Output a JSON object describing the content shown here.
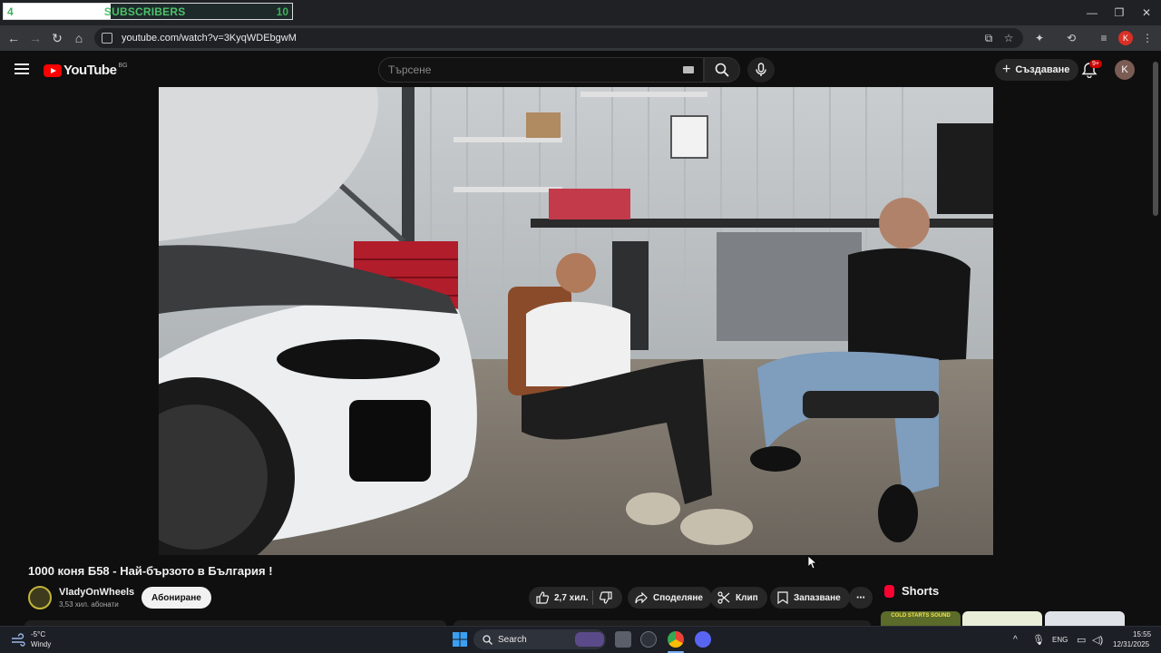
{
  "widget": {
    "left": "4",
    "label": "SUBSCRIBERS",
    "right": "10"
  },
  "browser": {
    "url": "youtube.com/watch?v=3KyqWDEbgwM",
    "profile_initial": "K"
  },
  "yt": {
    "logo_text": "YouTube",
    "region": "BG",
    "search_placeholder": "Търсене",
    "create_label": "Създаване",
    "notif_count": "9+",
    "avatar_initial": "K"
  },
  "video": {
    "title": "1000 коня Б58 - Най-бързото в България !",
    "channel": "VladyOnWheels",
    "subscribers": "3,53 хил. абонати",
    "subscribe_label": "Абониране",
    "likes": "2,7 хил.",
    "share_label": "Споделяне",
    "clip_label": "Клип",
    "save_label": "Запазване",
    "more_label": "⋯"
  },
  "shorts": {
    "title": "Shorts",
    "thumb_1_text": "COLD STARTS SOUND"
  },
  "taskbar": {
    "temp": "-5°C",
    "weather": "Windy",
    "search": "Search",
    "lang": "ENG",
    "time": "15:55",
    "date": "12/31/2025"
  },
  "colors": {
    "accent": "#ff0000",
    "subs_green": "#3fb15b",
    "bg": "#0f0f0f"
  }
}
